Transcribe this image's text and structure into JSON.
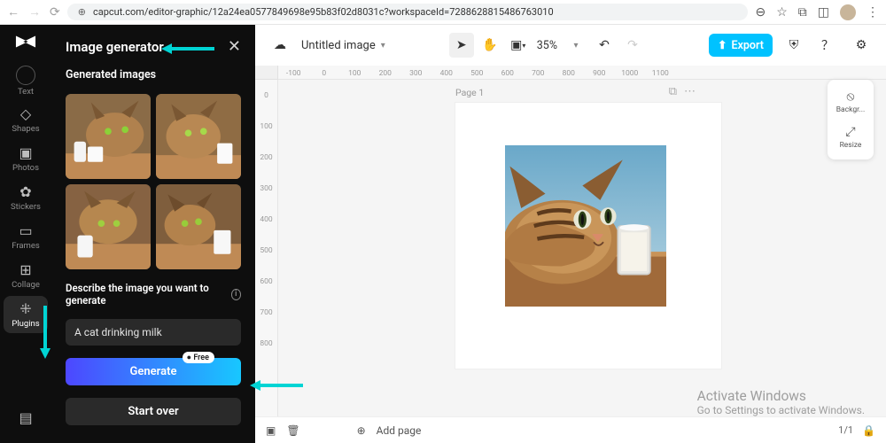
{
  "browser": {
    "url": "capcut.com/editor-graphic/12a24ea0577849698e95b83f02d8031c?workspaceId=7288628815486763010"
  },
  "rail": {
    "text": "Text",
    "shapes": "Shapes",
    "photos": "Photos",
    "stickers": "Stickers",
    "frames": "Frames",
    "collage": "Collage",
    "plugins": "Plugins"
  },
  "plugin": {
    "title": "Image generator",
    "generated_title": "Generated images",
    "describe": "Describe the image you want to generate",
    "prompt": "A cat drinking milk",
    "generate": "Generate",
    "free": "Free",
    "start_over": "Start over"
  },
  "top": {
    "doc_title": "Untitled image",
    "zoom": "35%",
    "export": "Export"
  },
  "ruler_h": [
    "-100",
    "0",
    "100",
    "200",
    "300",
    "400",
    "500",
    "600",
    "700",
    "800",
    "900",
    "1000",
    "1100"
  ],
  "ruler_v": [
    "0",
    "100",
    "200",
    "300",
    "400",
    "500",
    "600",
    "700",
    "800"
  ],
  "page": {
    "label": "Page 1"
  },
  "side": {
    "bg": "Backgr...",
    "resize": "Resize"
  },
  "bottom": {
    "add_page": "Add page",
    "page_count": "1/1"
  },
  "watermark": {
    "title": "Activate Windows",
    "sub": "Go to Settings to activate Windows."
  }
}
